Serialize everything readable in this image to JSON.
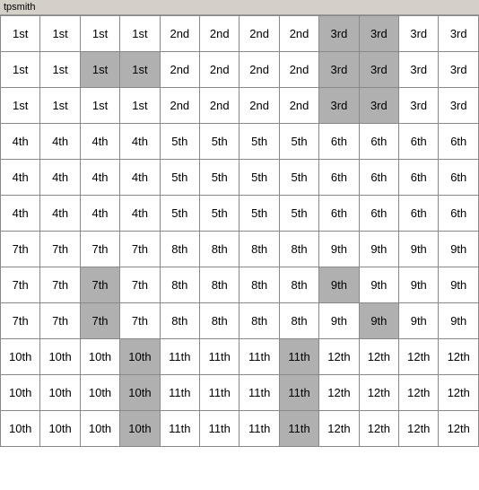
{
  "title": "tpsmith",
  "grid": {
    "rows": [
      [
        "1st",
        "1st",
        "1st",
        "1st",
        "2nd",
        "2nd",
        "2nd",
        "2nd",
        "3rd",
        "3rd",
        "3rd",
        "3rd"
      ],
      [
        "1st",
        "1st",
        "1st",
        "1st",
        "2nd",
        "2nd",
        "2nd",
        "2nd",
        "3rd",
        "3rd",
        "3rd",
        "3rd"
      ],
      [
        "1st",
        "1st",
        "1st",
        "1st",
        "2nd",
        "2nd",
        "2nd",
        "2nd",
        "3rd",
        "3rd",
        "3rd",
        "3rd"
      ],
      [
        "4th",
        "4th",
        "4th",
        "4th",
        "5th",
        "5th",
        "5th",
        "5th",
        "6th",
        "6th",
        "6th",
        "6th"
      ],
      [
        "4th",
        "4th",
        "4th",
        "4th",
        "5th",
        "5th",
        "5th",
        "5th",
        "6th",
        "6th",
        "6th",
        "6th"
      ],
      [
        "4th",
        "4th",
        "4th",
        "4th",
        "5th",
        "5th",
        "5th",
        "5th",
        "6th",
        "6th",
        "6th",
        "6th"
      ],
      [
        "7th",
        "7th",
        "7th",
        "7th",
        "8th",
        "8th",
        "8th",
        "8th",
        "9th",
        "9th",
        "9th",
        "9th"
      ],
      [
        "7th",
        "7th",
        "7th",
        "7th",
        "8th",
        "8th",
        "8th",
        "8th",
        "9th",
        "9th",
        "9th",
        "9th"
      ],
      [
        "7th",
        "7th",
        "7th",
        "7th",
        "8th",
        "8th",
        "8th",
        "8th",
        "9th",
        "9th",
        "9th",
        "9th"
      ],
      [
        "10th",
        "10th",
        "10th",
        "10th",
        "11th",
        "11th",
        "11th",
        "11th",
        "12th",
        "12th",
        "12th",
        "12th"
      ],
      [
        "10th",
        "10th",
        "10th",
        "10th",
        "11th",
        "11th",
        "11th",
        "11th",
        "12th",
        "12th",
        "12th",
        "12th"
      ],
      [
        "10th",
        "10th",
        "10th",
        "10th",
        "11th",
        "11th",
        "11th",
        "11th",
        "12th",
        "12th",
        "12th",
        "12th"
      ]
    ],
    "highlights": [
      [
        2,
        2
      ],
      [
        1,
        8
      ],
      [
        1,
        9
      ],
      [
        2,
        8
      ],
      [
        2,
        9
      ],
      [
        8,
        2
      ],
      [
        8,
        9
      ],
      [
        9,
        3
      ],
      [
        9,
        7
      ],
      [
        13,
        3
      ],
      [
        14,
        3
      ],
      [
        13,
        7
      ],
      [
        14,
        7
      ]
    ],
    "highlight_cells": {
      "1_2": true,
      "1_3": true,
      "0_8": true,
      "0_9": true,
      "1_8": true,
      "1_9": true,
      "2_8": true,
      "2_9": true,
      "7_2": true,
      "8_2": true,
      "7_8": true,
      "8_8": true,
      "8_9": true,
      "9_3": true,
      "10_3": true,
      "11_3": true,
      "9_7": true,
      "10_7": true,
      "11_7": true
    }
  }
}
